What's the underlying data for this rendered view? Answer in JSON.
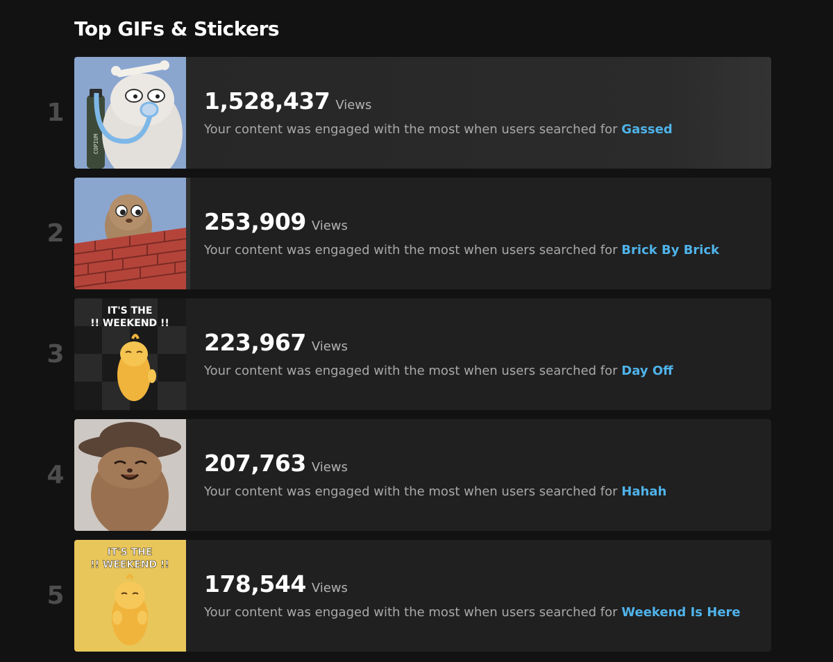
{
  "title": "Top GIFs & Stickers",
  "views_label": "Views",
  "description_prefix": "Your content was engaged with the most when users searched for",
  "colors": {
    "background": "#121212",
    "card": "#202020",
    "accent": "#4fb3ea",
    "rank": "#4d4d4d"
  },
  "items": [
    {
      "rank": "1",
      "views": "1,528,437",
      "search_term": "Gassed",
      "bar_fraction": 1.0,
      "thumbnail": {
        "icon": "copium-creature-thumbnail",
        "text": "COPIUM"
      }
    },
    {
      "rank": "2",
      "views": "253,909",
      "search_term": "Brick By Brick",
      "bar_fraction": 0.166
    },
    {
      "rank": "3",
      "views": "223,967",
      "search_term": "Day Off",
      "bar_fraction": 0.147,
      "thumbnail": {
        "caption": "IT'S THE",
        "caption2": "!! WEEKEND !!"
      }
    },
    {
      "rank": "4",
      "views": "207,763",
      "search_term": "Hahah",
      "bar_fraction": 0.136
    },
    {
      "rank": "5",
      "views": "178,544",
      "search_term": "Weekend Is Here",
      "bar_fraction": 0.117,
      "thumbnail": {
        "caption": "IT'S THE",
        "caption2": "!! WEEKEND !!"
      }
    }
  ]
}
